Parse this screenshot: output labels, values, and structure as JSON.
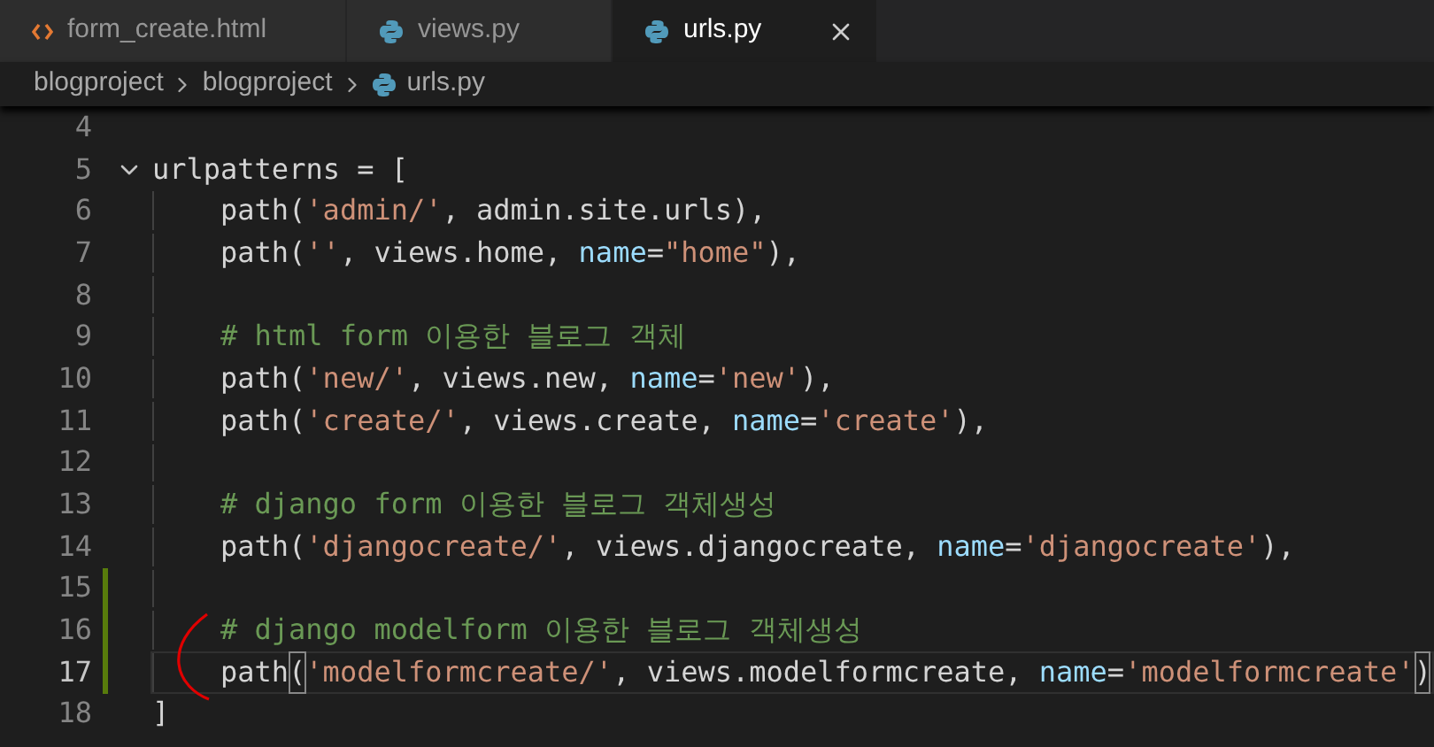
{
  "tabs": [
    {
      "label": "form_create.html",
      "kind": "html",
      "selected": false
    },
    {
      "label": "views.py",
      "kind": "python",
      "selected": false
    },
    {
      "label": "urls.py",
      "kind": "python",
      "selected": true
    }
  ],
  "breadcrumbs": [
    {
      "label": "blogproject",
      "kind": "folder"
    },
    {
      "label": "blogproject",
      "kind": "folder"
    },
    {
      "label": "urls.py",
      "kind": "python"
    }
  ],
  "lines": [
    {
      "number": "4",
      "current": false
    },
    {
      "number": "5",
      "current": false,
      "expanded": true,
      "tokens": [
        {
          "text": "urlpatterns = [",
          "kind": "plain"
        }
      ],
      "children": [
        {
          "number": "6",
          "current": false,
          "tokens": [
            {
              "text": "path(",
              "kind": "plain"
            },
            {
              "text": "'admin/'",
              "kind": "string"
            },
            {
              "text": ", admin.site.urls),",
              "kind": "plain"
            }
          ]
        },
        {
          "number": "7",
          "current": false,
          "tokens": [
            {
              "text": "path(",
              "kind": "plain"
            },
            {
              "text": "''",
              "kind": "string"
            },
            {
              "text": ", views.home, ",
              "kind": "plain"
            },
            {
              "text": "name",
              "kind": "param"
            },
            {
              "text": "=",
              "kind": "plain"
            },
            {
              "text": "\"home\"",
              "kind": "string"
            },
            {
              "text": "),",
              "kind": "plain"
            }
          ]
        },
        {
          "number": "8",
          "current": false
        },
        {
          "number": "9",
          "current": false,
          "tokens": [
            {
              "text": "# html form 이용한 블로그 객체",
              "kind": "comment"
            }
          ]
        },
        {
          "number": "10",
          "current": false,
          "tokens": [
            {
              "text": "path(",
              "kind": "plain"
            },
            {
              "text": "'new/'",
              "kind": "string"
            },
            {
              "text": ", views.new, ",
              "kind": "plain"
            },
            {
              "text": "name",
              "kind": "param"
            },
            {
              "text": "=",
              "kind": "plain"
            },
            {
              "text": "'new'",
              "kind": "string"
            },
            {
              "text": "),",
              "kind": "plain"
            }
          ]
        },
        {
          "number": "11",
          "current": false,
          "tokens": [
            {
              "text": "path(",
              "kind": "plain"
            },
            {
              "text": "'create/'",
              "kind": "string"
            },
            {
              "text": ", views.create, ",
              "kind": "plain"
            },
            {
              "text": "name",
              "kind": "param"
            },
            {
              "text": "=",
              "kind": "plain"
            },
            {
              "text": "'create'",
              "kind": "string"
            },
            {
              "text": "),",
              "kind": "plain"
            }
          ]
        },
        {
          "number": "12",
          "current": false
        },
        {
          "number": "13",
          "current": false,
          "tokens": [
            {
              "text": "# django form 이용한 블로그 객체생성",
              "kind": "comment"
            }
          ]
        },
        {
          "number": "14",
          "current": false,
          "tokens": [
            {
              "text": "path(",
              "kind": "plain"
            },
            {
              "text": "'djangocreate/'",
              "kind": "string"
            },
            {
              "text": ", views.djangocreate, ",
              "kind": "plain"
            },
            {
              "text": "name",
              "kind": "param"
            },
            {
              "text": "=",
              "kind": "plain"
            },
            {
              "text": "'djangocreate'",
              "kind": "string"
            },
            {
              "text": "),",
              "kind": "plain"
            }
          ]
        },
        {
          "number": "15",
          "modified": true,
          "current": false
        },
        {
          "number": "16",
          "modified": true,
          "current": false,
          "tokens": [
            {
              "text": "# django modelform 이용한 블로그 객체생성",
              "kind": "comment"
            }
          ]
        },
        {
          "number": "17",
          "modified": true,
          "current": true,
          "tokens": [
            {
              "text": "path",
              "kind": "plain"
            },
            {
              "text": "(",
              "kind": "bracket"
            },
            {
              "text": "'modelformcreate/'",
              "kind": "string"
            },
            {
              "text": ", views.modelformcreate, ",
              "kind": "plain"
            },
            {
              "text": "name",
              "kind": "param"
            },
            {
              "text": "=",
              "kind": "plain"
            },
            {
              "text": "'modelformcreate'",
              "kind": "string"
            },
            {
              "text": ")",
              "kind": "bracket"
            }
          ]
        }
      ]
    },
    {
      "number": "18",
      "current": false,
      "tokens": [
        {
          "text": "]",
          "kind": "plain"
        }
      ]
    }
  ]
}
